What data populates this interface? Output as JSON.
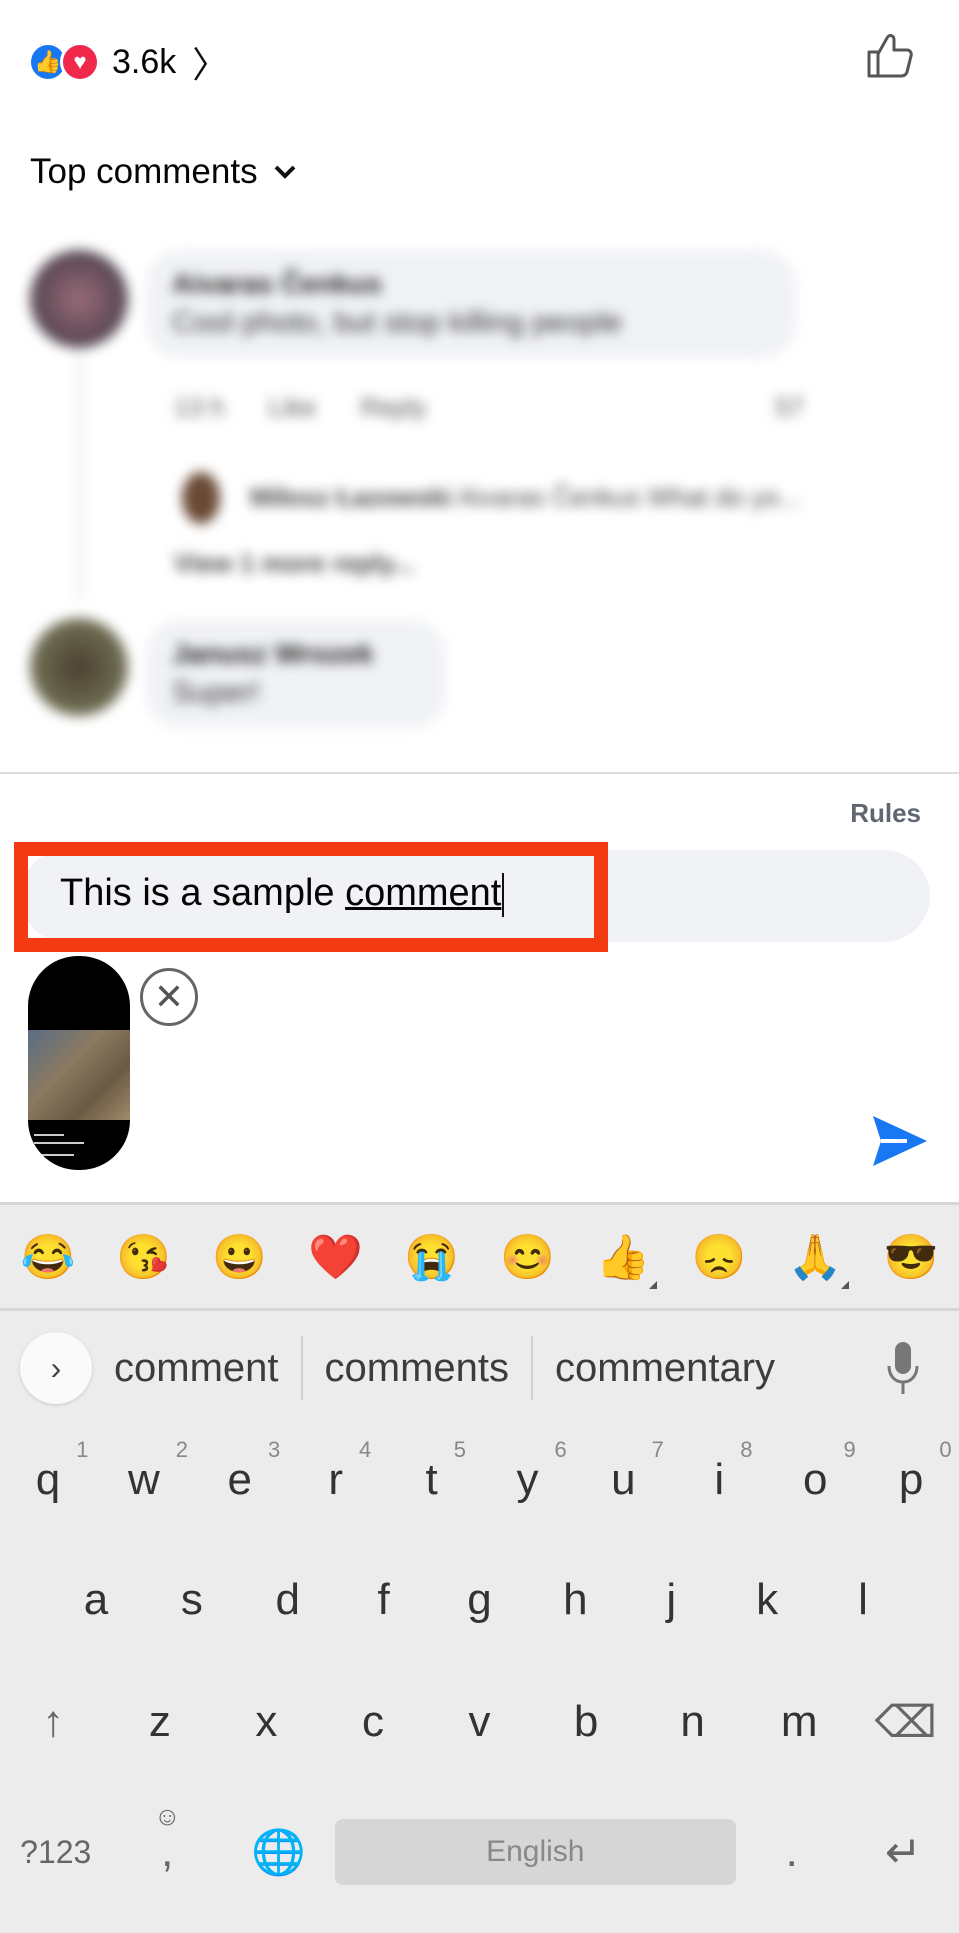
{
  "reactions": {
    "count": "3.6k",
    "icons": [
      "like-icon",
      "love-icon"
    ]
  },
  "sort": {
    "label": "Top comments"
  },
  "comments": [
    {
      "author": "Aivaras Čenkus",
      "text": "Cool photo, but stop killing people",
      "time": "13 h",
      "like": "Like",
      "reply": "Reply",
      "reaction_count": "57",
      "reply_preview": {
        "author": "Miłosz Łazowski",
        "text": "Aivaras Čenkus What do yo..."
      },
      "view_more": "View 1 more reply..."
    },
    {
      "author": "Janusz Wrozek",
      "text": "Super!"
    }
  ],
  "composer": {
    "rules": "Rules",
    "value_prefix": "This is a sample ",
    "value_word": "comment"
  },
  "keyboard": {
    "emojis": [
      "😂",
      "😘",
      "😀",
      "❤️",
      "😭",
      "😊",
      "👍",
      "😞",
      "🙏",
      "😎"
    ],
    "suggestions": [
      "comment",
      "comments",
      "commentary"
    ],
    "row1": [
      {
        "k": "q",
        "n": "1"
      },
      {
        "k": "w",
        "n": "2"
      },
      {
        "k": "e",
        "n": "3"
      },
      {
        "k": "r",
        "n": "4"
      },
      {
        "k": "t",
        "n": "5"
      },
      {
        "k": "y",
        "n": "6"
      },
      {
        "k": "u",
        "n": "7"
      },
      {
        "k": "i",
        "n": "8"
      },
      {
        "k": "o",
        "n": "9"
      },
      {
        "k": "p",
        "n": "0"
      }
    ],
    "row2": [
      "a",
      "s",
      "d",
      "f",
      "g",
      "h",
      "j",
      "k",
      "l"
    ],
    "row3": [
      "z",
      "x",
      "c",
      "v",
      "b",
      "n",
      "m"
    ],
    "symbols_label": "?123",
    "comma": ",",
    "space_label": "English",
    "period": "."
  }
}
